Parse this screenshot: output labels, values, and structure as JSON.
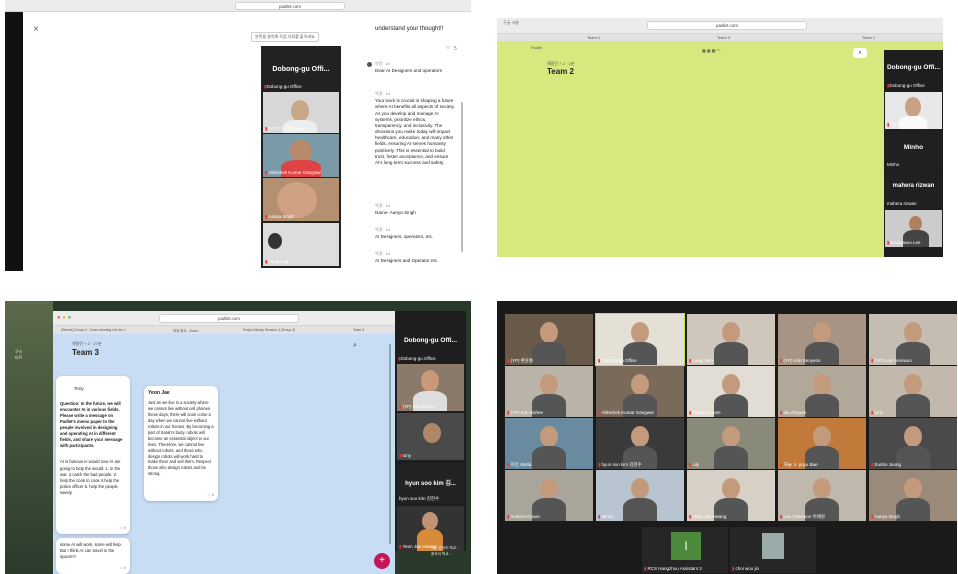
{
  "q1": {
    "browser_url": "padlet.com",
    "close_glyph": "×",
    "info_bar": "왼쪽을 클릭해 직접 자료를 붙이세요",
    "heading_partial": "understand your thought!!",
    "comment_count": "5",
    "video_title": "Dobong-gu Offi...",
    "video_subtitle": "Dobong-gu Office",
    "tiles": [
      {
        "name": "(YP) Kim Seoyeon"
      },
      {
        "name": "Abhishek Kumar Gangwar"
      },
      {
        "name": "Aanya Singh"
      },
      {
        "name": "Taegeong"
      }
    ],
    "comments": [
      {
        "who": "익명 · 1d",
        "text": "Dear  AI Designers and operators"
      },
      {
        "who": "익명 · 1d",
        "text": "Your work is crucial in shaping a future where AI benefits all aspects of society. As you develop and manage AI systems, prioritize ethics, transparency, and inclusivity. The decisions you make today will impact healthcare, education, and many other fields, ensuring AI serves humanity positively. This is essential to build trust, foster acceptance, and ensure AI's long term success and safety."
      },
      {
        "who": "익명 · 1d",
        "text": "Name- Aanya Singh"
      },
      {
        "who": "익명 · 1d",
        "text": "AI Designers, operators, etc."
      },
      {
        "who": "익명 · 1d",
        "text": "AI Designers and Operator etc."
      }
    ]
  },
  "q2": {
    "menu_left": "구글 크롬",
    "browser_url": "padlet.com",
    "tabs": [
      "Team 2",
      "Team 3",
      "Team 1"
    ],
    "brand": "Padlet",
    "board_meta": "해밀턴 + 2 · 1분",
    "board_title": "Team 2",
    "toolbar_icons": "▦ ▦ ▦ ⁺⁺",
    "video_title": "Dobong-gu Offi...",
    "tiles": [
      {
        "label": "Dobong-gu Office",
        "kind": "small"
      },
      {
        "label": "(YP) Lee Yeonwoo",
        "kind": "video"
      },
      {
        "label": "Minho",
        "kind": "name",
        "display": "Minho"
      },
      {
        "label": "mahera rizwan",
        "kind": "name",
        "display": "mahera rizwan"
      },
      {
        "label": "Seongwoo Lee",
        "kind": "video"
      }
    ]
  },
  "q3": {
    "browser_url": "padlet.com",
    "tabs": [
      "[Sheets] Group 4 - Zoom meeting info for f...",
      "파워 중국 - Zoom",
      "Project Meary Session 4 (Group 3)",
      "Team 3"
    ],
    "board_meta": "해밀턴 + 2 · 27분",
    "board_title": "Team 3",
    "card1": {
      "author": "Tony",
      "question": "Question: In the future, we will encounter AI in various fields. Please write a message on Padlet's memo paper to the people involved in designing and operating AI in different fields, and share your message with participants.",
      "answer": "AI is famous in would now AI are going to help the would.   1. in the war.     2.catch the bad people. 3. help the cook to cook 4.help the police officer 5. help the people savely.",
      "count": "0"
    },
    "card2": {
      "author": "Yeon Jae",
      "text": "Just as we live in a society where we cannot live without cell phones these days, there will soon come a day when we cannot live without robots in our homes. By becoming a part of Sarah's body, robots will become an essential object in our lives. Therefore, we cannot live without robots, and those who design robots will work hard to make them and sell them. Respect those who design robots and be strong.",
      "count": "0"
    },
    "card3": {
      "text": "some AI will work, some will help. But I think AI can travel in the space!!!!",
      "count": "0"
    },
    "card1_count": "0",
    "add_button": "+",
    "video_title": "Dobong-gu Offi...",
    "video_subtitle": "Dobong-gu Office",
    "tiles": [
      {
        "label": "(YP) Kim Dohee"
      },
      {
        "label": "tony"
      },
      {
        "label": "hyun soo kim 김..."
      },
      {
        "label": "Yeon Jae Hwang"
      }
    ],
    "tile_name_display": "hyun soo kim 김...",
    "tile_name_sub": "hyun soo kim 김현수",
    "side_labels": [
      "제주 중국어 학교...",
      "중국어 학교..."
    ],
    "left_labels": [
      "구스",
      "타트"
    ]
  },
  "q4": {
    "grid": [
      [
        "(YP) 환윤통",
        "Dobong-gu Office",
        "Lang_Wen",
        "(YP) Kim Seoyeon",
        "(YP) Lee Yeonwoo"
      ],
      [
        "(YP) Kim Dohee",
        "Abhishek Kumar Gangwar",
        "Taegeon Nam",
        "ala zhiyuan",
        "tony"
      ],
      [
        "이민 Stella",
        "hyun soo kim 김현수",
        "Lily",
        "하늘 ☺ yuyu Bae",
        "Eunho Jeong"
      ],
      [
        "mahera rizwan",
        "Minho",
        "Yeon Jae Hwang",
        "Lee Chaewon 이채원",
        "Aanya Singh"
      ]
    ],
    "bottom": [
      {
        "label": "RCS Hangzhou Assistant 3",
        "initial": "I"
      },
      {
        "label": "choi woo jin"
      }
    ]
  },
  "colors": {
    "q2_board": "#d6e87e",
    "q3_board": "#c8dcf4",
    "zoom_bg": "#1a1a1a",
    "accent_add": "#c2185b",
    "active_border": "#b8e04a"
  }
}
